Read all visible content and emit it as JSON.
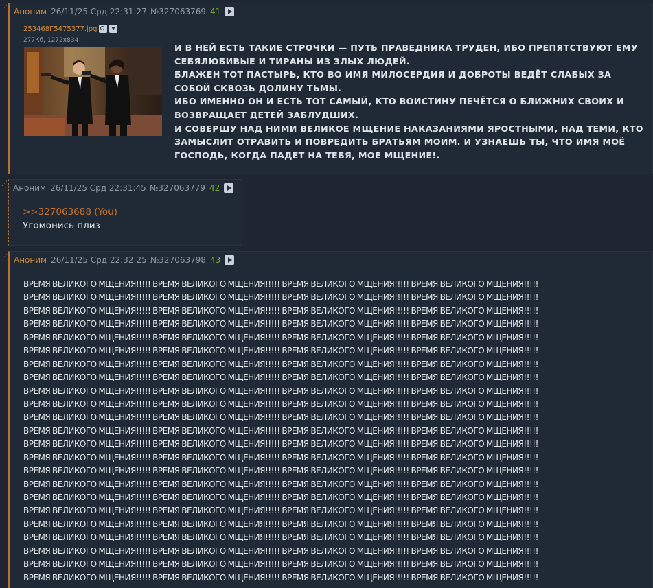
{
  "posts": [
    {
      "name": "Аноним",
      "date": "26/11/25 Срд 22:31:27",
      "number": "№327063769",
      "count": "41",
      "file": {
        "name": "253468Г5475377.jpg",
        "meta": "277Кб, 1272x834"
      },
      "text": [
        "И В НЕЙ ЕСТЬ ТАКИЕ СТРОЧКИ — ПУТЬ ПРАВЕДНИКА ТРУДЕН, ИБО ПРЕПЯТСТВУЮТ ЕМУ СЕБЯЛЮБИВЫЕ И ТИРАНЫ ИЗ ЗЛЫХ ЛЮДЕЙ.",
        "БЛАЖЕН ТОТ ПАСТЫРЬ, КТО ВО ИМЯ МИЛОСЕРДИЯ И ДОБРОТЫ ВЕДЁТ СЛАБЫХ ЗА СОБОЙ СКВОЗЬ ДОЛИНУ ТЬМЫ.",
        "ИБО ИМЕННО ОН И ЕСТЬ ТОТ САМЫЙ, КТО ВОИСТИНУ ПЕЧЁТСЯ О БЛИЖНИХ СВОИХ И ВОЗВРАЩАЕТ ДЕТЕЙ ЗАБЛУДШИХ.",
        "И СОВЕРШУ НАД НИМИ ВЕЛИКОЕ МЩЕНИЕ НАКАЗАНИЯМИ ЯРОСТНЫМИ, НАД ТЕМИ, КТО ЗАМЫСЛИТ ОТРАВИТЬ И ПОВРЕДИТЬ БРАТЬЯМ МОИМ. И УЗНАЕШЬ ТЫ, ЧТО ИМЯ МОЁ ГОСПОДЬ, КОГДА ПАДЕТ НА ТЕБЯ, МОЕ МЩЕНИЕ!."
      ]
    },
    {
      "name": "Аноним",
      "date": "26/11/25 Срд 22:31:45",
      "number": "№327063779",
      "count": "42",
      "reply_link": ">>327063688 (You)",
      "text": "Угомонись плиз"
    },
    {
      "name": "Аноним",
      "date": "26/11/25 Срд 22:32:25",
      "number": "№327063798",
      "count": "43",
      "repeat_phrase": "ВРЕМЯ ВЕЛИКОГО МЩЕНИЯ!!!!!",
      "phrases_per_line": 4,
      "visible_lines": 23
    }
  ],
  "colors": {
    "background": "#1e2631",
    "post_background": "#202a36",
    "accent_orange": "#d08a3a",
    "reply_count_green": "#6fae2d",
    "text": "#dfe4ea",
    "muted": "#8f99a3"
  },
  "icons": {
    "play": "play-icon",
    "search": "search-icon",
    "download": "download-icon",
    "dots": "post-menu-dots-icon"
  }
}
